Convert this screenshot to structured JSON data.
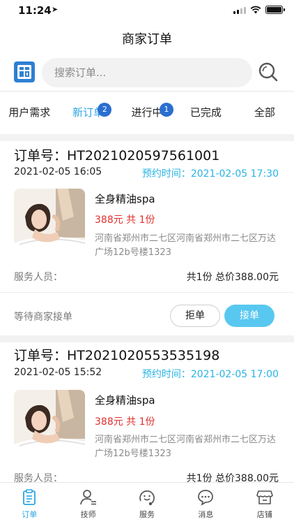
{
  "status_bar": {
    "time": "11:24"
  },
  "header": {
    "title": "商家订单"
  },
  "search": {
    "placeholder": "搜索订单..."
  },
  "tabs": [
    {
      "label": "用户需求",
      "badge": ""
    },
    {
      "label": "新订单",
      "badge": "2"
    },
    {
      "label": "进行中",
      "badge": "1"
    },
    {
      "label": "已完成",
      "badge": ""
    },
    {
      "label": "全部",
      "badge": ""
    }
  ],
  "active_tab": "新订单",
  "orders": [
    {
      "order_no": "订单号：HT2021020597561001",
      "date": "2021-02-05 16:05",
      "appointment": "预约时间：2021-02-05 17:30",
      "service_name": "全身精油spa",
      "price": "388元 共 1份",
      "address": "河南省郑州市二七区河南省郑州市二七区万达广场12b号楼1323",
      "staff_label": "服务人员：",
      "total": "共1份 总价388.00元",
      "status": "等待商家接单",
      "reject_label": "拒单",
      "accept_label": "接单"
    },
    {
      "order_no": "订单号：HT2021020553535198",
      "date": "2021-02-05 15:52",
      "appointment": "预约时间：2021-02-05 17:00",
      "service_name": "全身精油spa",
      "price": "388元 共 1份",
      "address": "河南省郑州市二七区河南省郑州市二七区万达广场12b号楼1323",
      "staff_label": "服务人员：",
      "total": "共1份 总价388.00元"
    }
  ],
  "bottom_nav": [
    {
      "label": "订单",
      "icon": "clipboard-icon"
    },
    {
      "label": "技师",
      "icon": "person-list-icon"
    },
    {
      "label": "服务",
      "icon": "smile-icon"
    },
    {
      "label": "消息",
      "icon": "chat-bubble-icon"
    },
    {
      "label": "店铺",
      "icon": "store-icon"
    }
  ],
  "colors": {
    "accent": "#2aa6e0",
    "badge": "#2a6fd0",
    "price": "#e0312f",
    "accept": "#58c8f0"
  }
}
